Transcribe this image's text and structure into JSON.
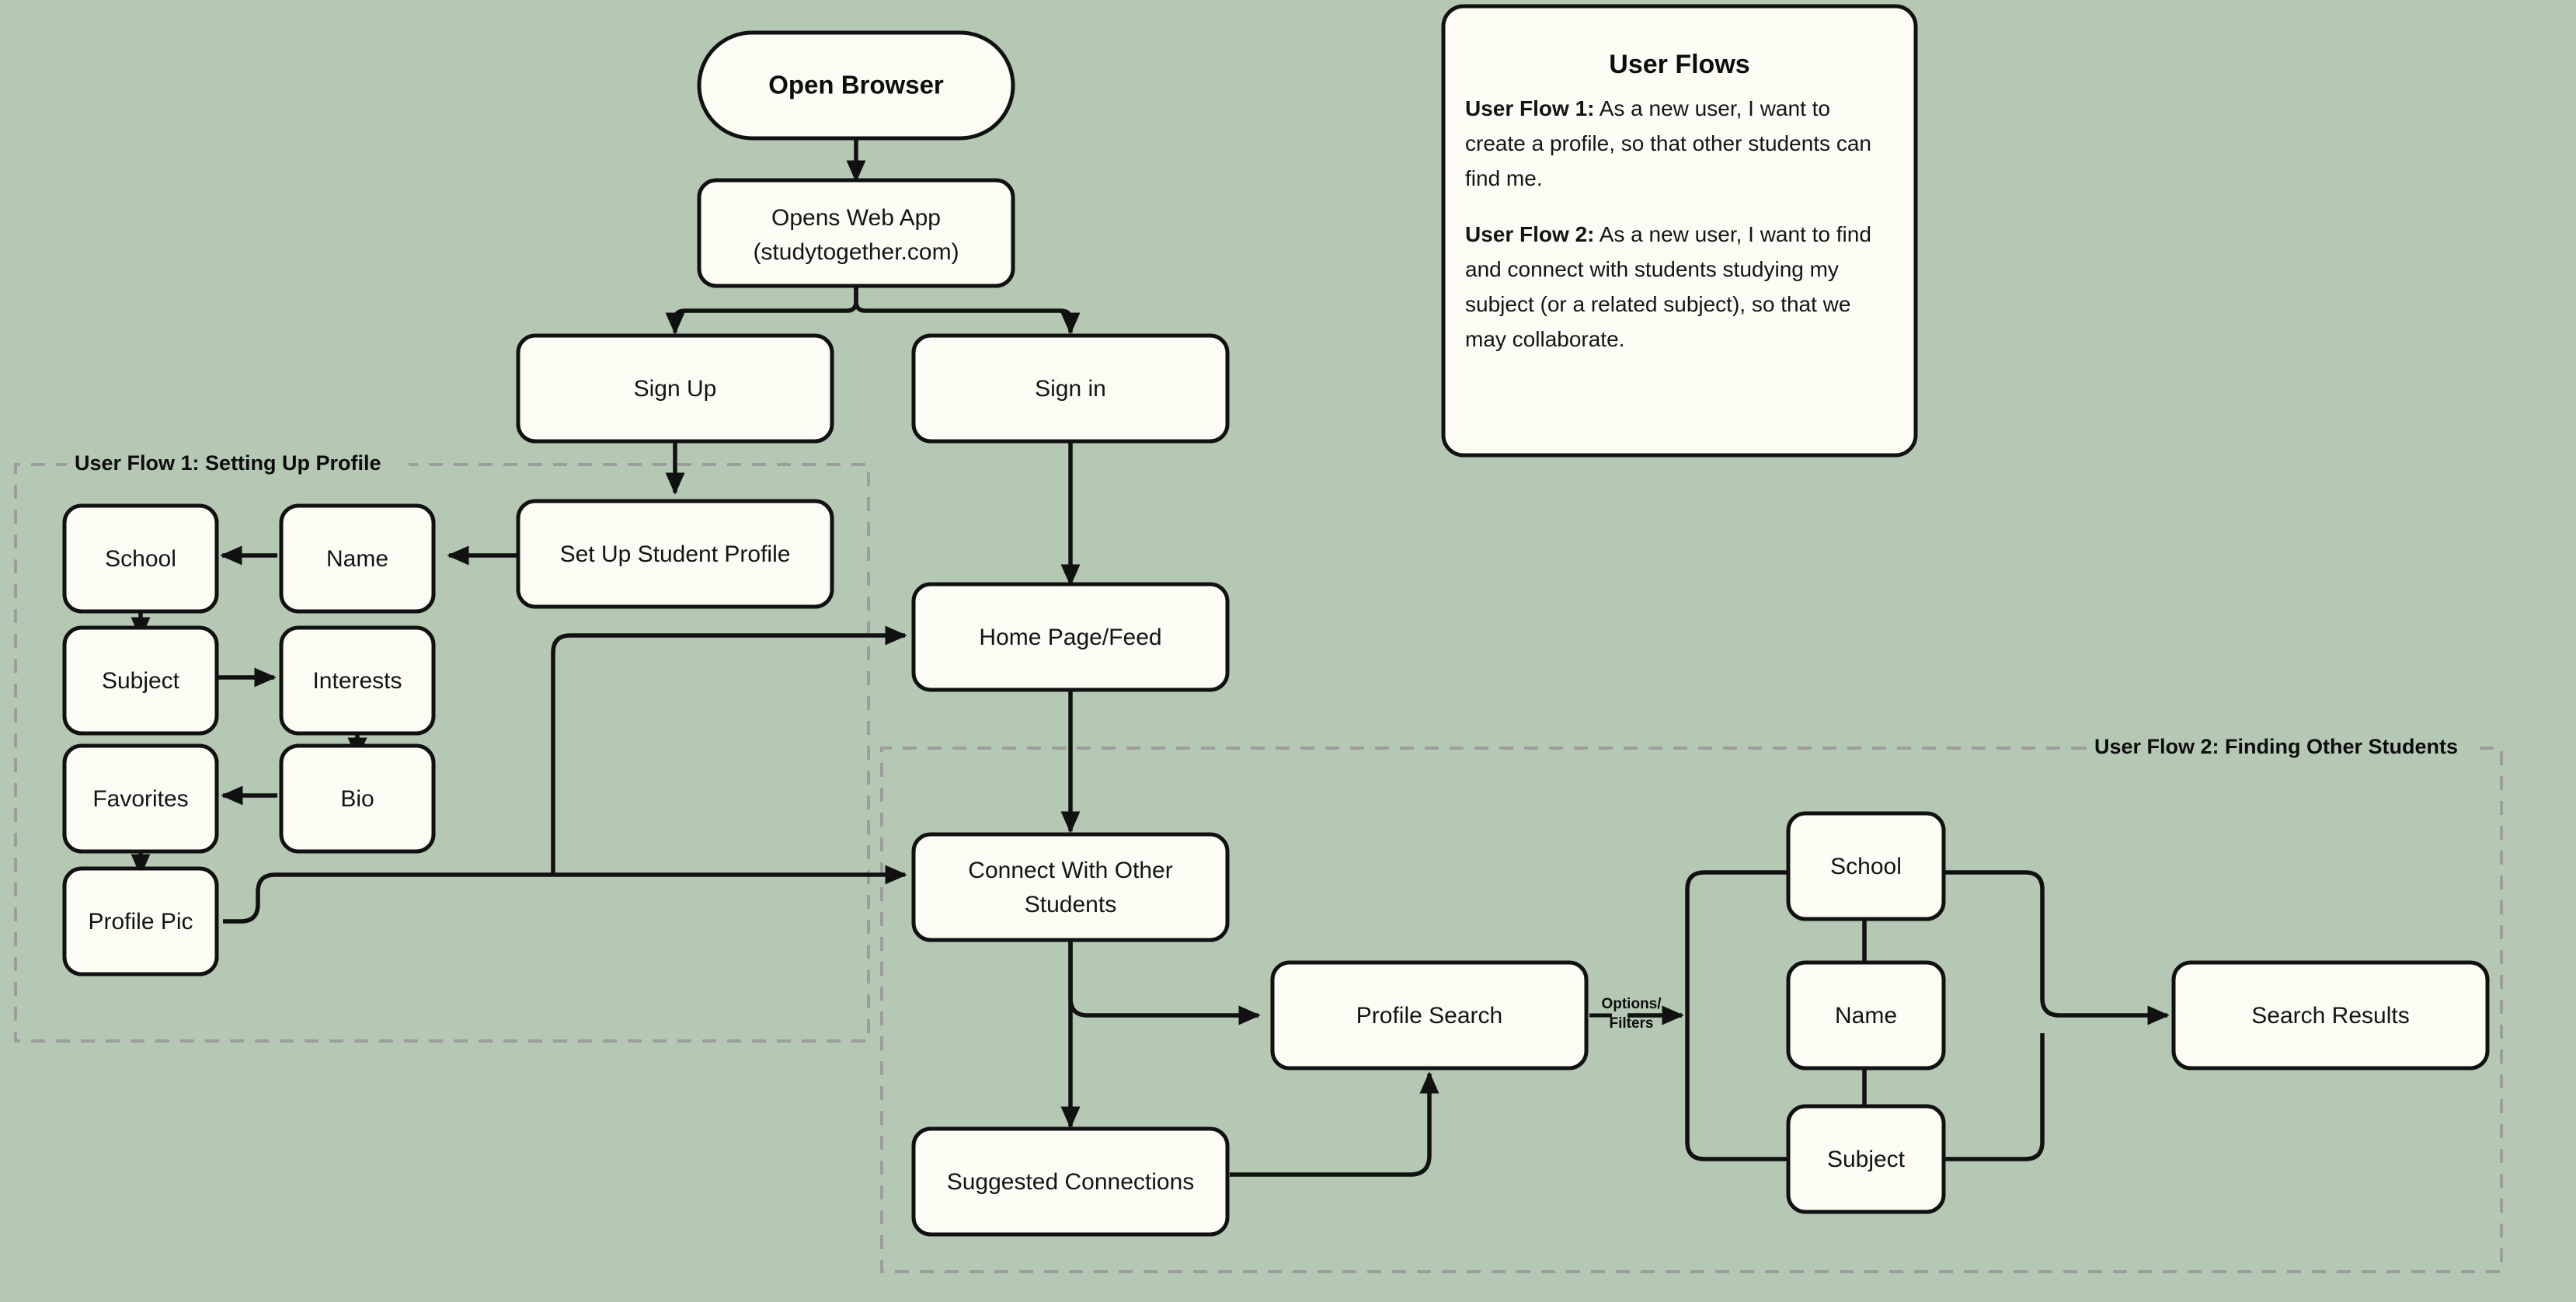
{
  "canvas": {
    "background_color": "#b5c8b4",
    "node_fill_color": "#fcfcf5",
    "node_stroke_color": "#111111",
    "group_border_color": "#9d9d9d"
  },
  "nodes": {
    "open_browser": "Open Browser",
    "opens_web_app_line1": "Opens Web App",
    "opens_web_app_line2": "(studytogether.com)",
    "sign_up": "Sign Up",
    "sign_in": "Sign in",
    "set_up_student_profile": "Set Up Student Profile",
    "home_page_feed": "Home Page/Feed",
    "school_profile": "School",
    "name_profile": "Name",
    "subject_profile": "Subject",
    "interests": "Interests",
    "favorites": "Favorites",
    "bio": "Bio",
    "profile_pic": "Profile Pic",
    "connect_line1": "Connect With Other",
    "connect_line2": "Students",
    "profile_search": "Profile Search",
    "suggested_connections": "Suggested Connections",
    "school_search": "School",
    "name_search": "Name",
    "subject_search": "Subject",
    "search_results": "Search Results"
  },
  "edge_labels": {
    "options_filters_line1": "Options/",
    "options_filters_line2": "Filters"
  },
  "groups": {
    "flow1_title": "User Flow 1: Setting Up Profile",
    "flow2_title": "User Flow 2: Finding Other Students"
  },
  "legend": {
    "title": "User Flows",
    "flow1_label": "User Flow 1:",
    "flow1_text": " As a new user, I want to create a profile, so that other students can find me.",
    "flow2_label": "User Flow 2:",
    "flow2_text": " As a new user, I want to find and connect with students studying my subject (or a related subject), so that we may collaborate."
  }
}
